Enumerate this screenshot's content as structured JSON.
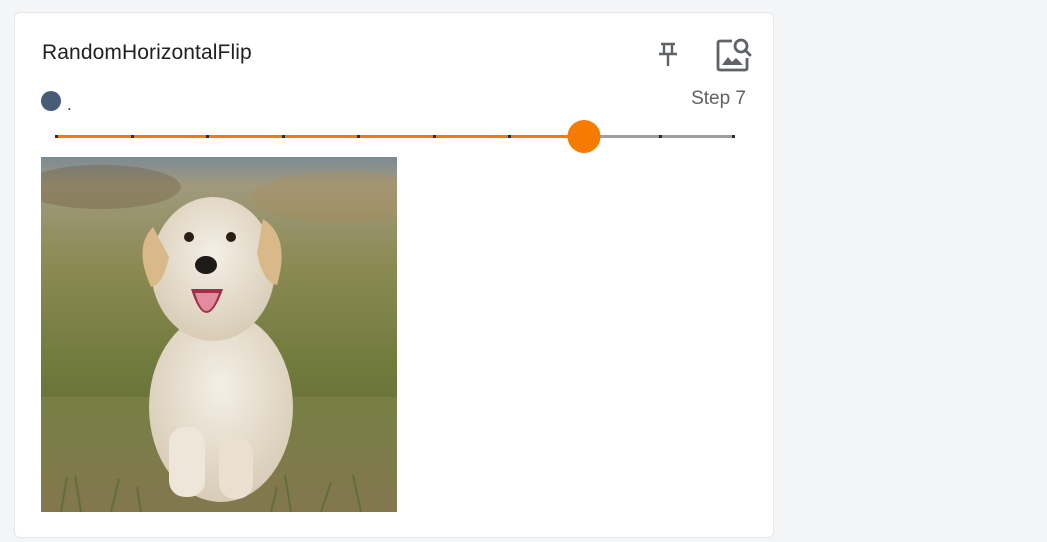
{
  "card": {
    "title": "RandomHorizontalFlip",
    "run_label": ".",
    "step_label": "Step 7",
    "run_color": "#485b78",
    "pin_icon": "pin-icon",
    "zoom_icon": "image-search-icon"
  },
  "slider": {
    "min_step": 0,
    "max_step": 9,
    "value": 7,
    "accent_color": "#f57c00",
    "track_color": "#9e9e9e"
  },
  "image": {
    "subject": "puppy-running-on-grass"
  }
}
